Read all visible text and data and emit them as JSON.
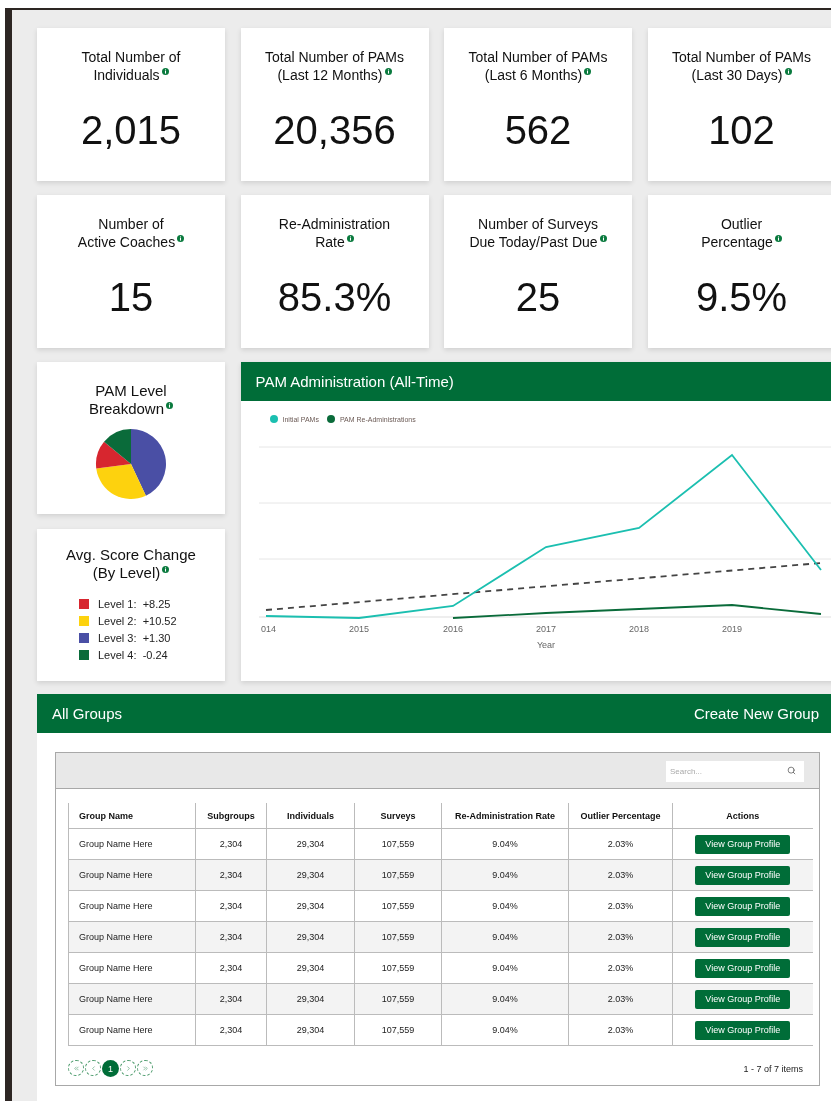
{
  "stats": [
    {
      "title": "Total Number of\nIndividuals",
      "value": "2,015"
    },
    {
      "title": "Total Number of PAMs\n(Last 12 Months)",
      "value": "20,356"
    },
    {
      "title": "Total Number of PAMs\n(Last 6 Months)",
      "value": "562"
    },
    {
      "title": "Total Number of PAMs\n(Last 30 Days)",
      "value": "102"
    },
    {
      "title": "Number of\nActive Coaches",
      "value": "15"
    },
    {
      "title": "Re-Administration\nRate",
      "value": "85.3%"
    },
    {
      "title": "Number of Surveys\nDue Today/Past Due",
      "value": "25"
    },
    {
      "title": "Outlier\nPercentage",
      "value": "9.5%"
    }
  ],
  "level_breakdown": {
    "title": "PAM Level\nBreakdown"
  },
  "score_change": {
    "title": "Avg. Score Change\n(By Level)",
    "levels": [
      {
        "label": "Level 1:",
        "value": "+8.25",
        "color": "#d7262f"
      },
      {
        "label": "Level 2:",
        "value": "+10.52",
        "color": "#fdd20e"
      },
      {
        "label": "Level 3:",
        "value": "+1.30",
        "color": "#4a4fa5"
      },
      {
        "label": "Level 4:",
        "value": "-0.24",
        "color": "#0a6b3a"
      }
    ]
  },
  "administration_chart": {
    "title": "PAM Administration (All-Time)",
    "legend": [
      {
        "label": "Initial PAMs",
        "color": "#1bbfb0"
      },
      {
        "label": "PAM Re-Administrations",
        "color": "#0a6b3a"
      }
    ],
    "x_tick_labels": [
      "014",
      "2015",
      "2016",
      "2017",
      "2018",
      "2019"
    ],
    "x_axis_title": "Year"
  },
  "groups": {
    "title": "All Groups",
    "create_link": "Create New Group",
    "search": {
      "placeholder": "Search..."
    },
    "columns": [
      "Group Name",
      "Subgroups",
      "Individuals",
      "Surveys",
      "Re-Administration Rate",
      "Outlier Percentage",
      "Actions"
    ],
    "rows": [
      {
        "cells": [
          "Group Name Here",
          "2,304",
          "29,304",
          "107,559",
          "9.04%",
          "2.03%"
        ],
        "action": "View Group Profile"
      },
      {
        "cells": [
          "Group Name Here",
          "2,304",
          "29,304",
          "107,559",
          "9.04%",
          "2.03%"
        ],
        "action": "View Group Profile"
      },
      {
        "cells": [
          "Group Name Here",
          "2,304",
          "29,304",
          "107,559",
          "9.04%",
          "2.03%"
        ],
        "action": "View Group Profile"
      },
      {
        "cells": [
          "Group Name Here",
          "2,304",
          "29,304",
          "107,559",
          "9.04%",
          "2.03%"
        ],
        "action": "View Group Profile"
      },
      {
        "cells": [
          "Group Name Here",
          "2,304",
          "29,304",
          "107,559",
          "9.04%",
          "2.03%"
        ],
        "action": "View Group Profile"
      },
      {
        "cells": [
          "Group Name Here",
          "2,304",
          "29,304",
          "107,559",
          "9.04%",
          "2.03%"
        ],
        "action": "View Group Profile"
      },
      {
        "cells": [
          "Group Name Here",
          "2,304",
          "29,304",
          "107,559",
          "9.04%",
          "2.03%"
        ],
        "action": "View Group Profile"
      }
    ],
    "pages": [
      {
        "label": "1",
        "selected": true
      }
    ],
    "items_summary": "1 - 7 of 7 items"
  }
}
